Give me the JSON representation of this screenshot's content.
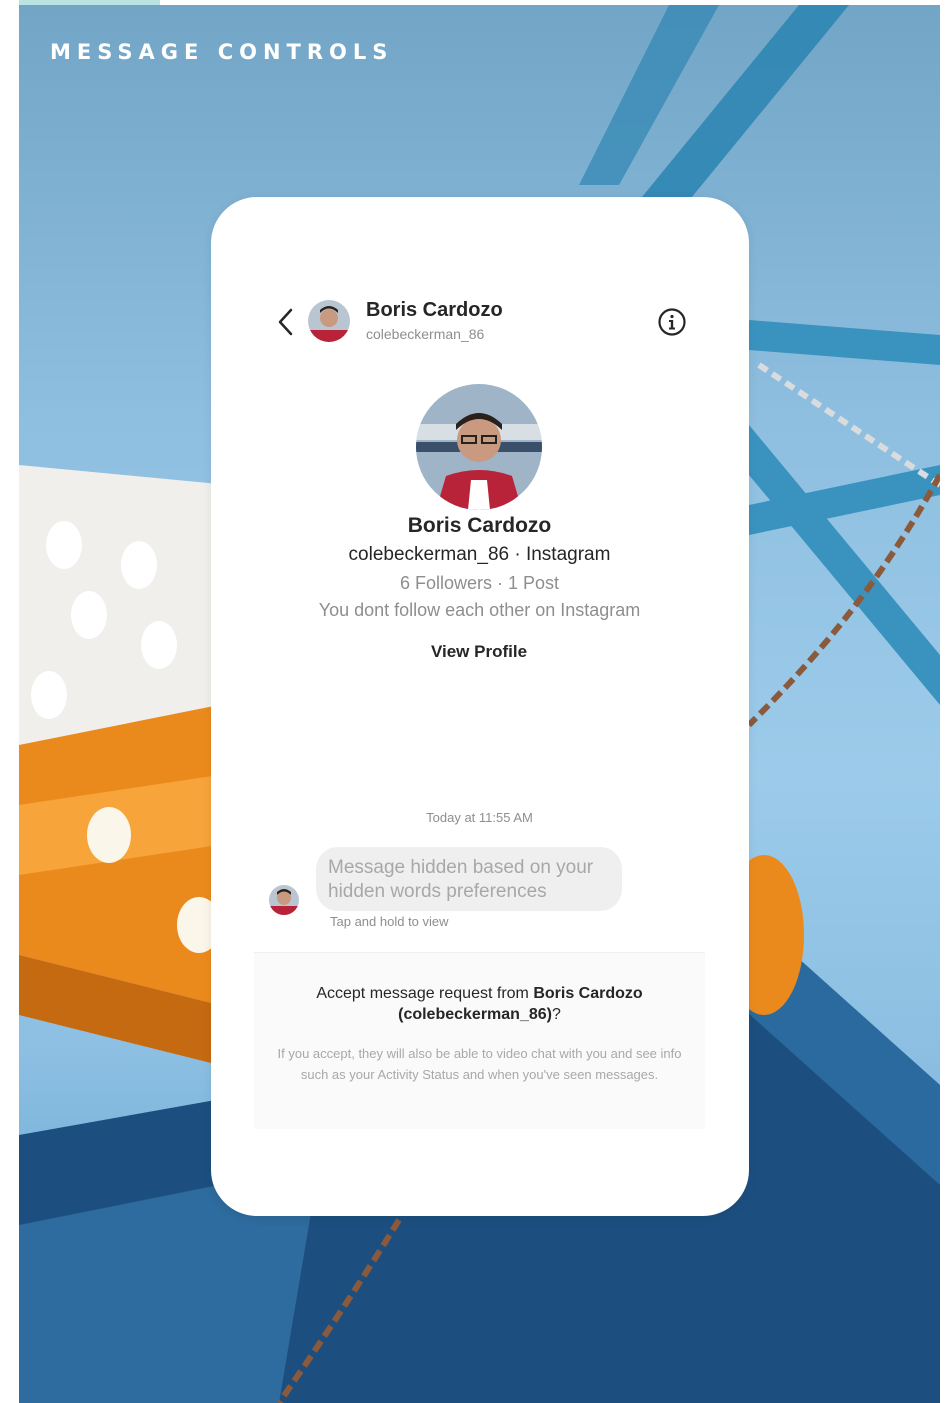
{
  "page": {
    "section_label": "MESSAGE CONTROLS",
    "accent_color": "#b9e4df"
  },
  "header": {
    "name": "Boris Cardozo",
    "username": "colebeckerman_86",
    "back_icon": "chevron-left-icon",
    "info_icon": "info-circle-icon"
  },
  "profile": {
    "name": "Boris Cardozo",
    "meta": "colebeckerman_86 · Instagram",
    "stats": "6 Followers · 1 Post",
    "relationship": "You dont follow each other on Instagram",
    "view_profile_label": "View Profile"
  },
  "thread": {
    "timestamp": "Today at 11:55 AM",
    "hidden_message_line1": "Message hidden based on your",
    "hidden_message_line2": "hidden words preferences",
    "tap_hint": "Tap and hold to view"
  },
  "request": {
    "prefix": "Accept message request from ",
    "name": "Boris Cardozo",
    "username_paren": "(colebeckerman_86)",
    "suffix": "?",
    "description": "If you accept, they will also be able to video chat with you and see info such as your Activity Status and when you've seen messages."
  },
  "colors": {
    "text_primary": "#262626",
    "text_secondary": "#8e8e8e",
    "bubble_bg": "#efefef"
  }
}
